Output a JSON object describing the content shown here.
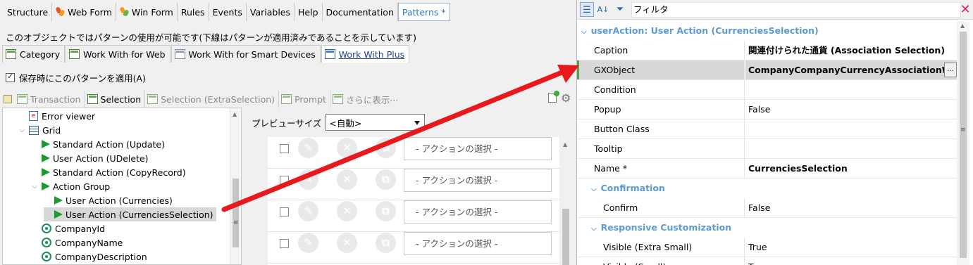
{
  "top_tabs": [
    {
      "label": "Structure",
      "icon": null
    },
    {
      "label": "Web Form",
      "icon": "webform-icon"
    },
    {
      "label": "Win Form",
      "icon": "winform-icon"
    },
    {
      "label": "Rules",
      "icon": null
    },
    {
      "label": "Events",
      "icon": null
    },
    {
      "label": "Variables",
      "icon": null
    },
    {
      "label": "Help",
      "icon": null
    },
    {
      "label": "Documentation",
      "icon": null
    },
    {
      "label": "Patterns *",
      "icon": null,
      "active": true
    }
  ],
  "info_text": "このオブジェクトではパターンの使用が可能です(下線はパターンが適用済みであることを示しています)",
  "pattern_tabs": [
    {
      "label": "Category"
    },
    {
      "label": "Work With for Web"
    },
    {
      "label": "Work With for Smart Devices"
    },
    {
      "label": "Work With Plus",
      "active": true
    }
  ],
  "apply_checkbox": {
    "label": "保存時にこのパターンを適用(A)",
    "checked": true
  },
  "instance_tabs": [
    {
      "label": "Transaction",
      "active": false
    },
    {
      "label": "Selection",
      "active": true
    },
    {
      "label": "Selection (ExtraSelection)",
      "active": false
    },
    {
      "label": "Prompt",
      "active": false
    },
    {
      "label": "さらに表示···",
      "active": false
    }
  ],
  "tree": [
    {
      "label": "Error viewer",
      "icon": "error-viewer-icon",
      "indent": 1,
      "expander": ""
    },
    {
      "label": "Grid",
      "icon": "grid-icon",
      "indent": 1,
      "expander": "⌵"
    },
    {
      "label": "Standard Action (Update)",
      "icon": "action-flag-icon",
      "indent": 2,
      "expander": ""
    },
    {
      "label": "User Action (UDelete)",
      "icon": "action-flag-icon",
      "indent": 2,
      "expander": ""
    },
    {
      "label": "Standard Action (CopyRecord)",
      "icon": "action-flag-icon",
      "indent": 2,
      "expander": ""
    },
    {
      "label": "Action Group",
      "icon": "action-flag-icon",
      "indent": 2,
      "expander": "⌵"
    },
    {
      "label": "User Action (Currencies)",
      "icon": "action-flag-icon",
      "indent": 3,
      "expander": ""
    },
    {
      "label": "User Action (CurrenciesSelection)",
      "icon": "action-flag-icon",
      "indent": 3,
      "expander": "",
      "selected": true
    },
    {
      "label": "CompanyId",
      "icon": "attribute-icon",
      "indent": 2,
      "expander": ""
    },
    {
      "label": "CompanyName",
      "icon": "attribute-icon",
      "indent": 2,
      "expander": ""
    },
    {
      "label": "CompanyDescription",
      "icon": "attribute-icon",
      "indent": 2,
      "expander": ""
    }
  ],
  "preview": {
    "size_label": "プレビューサイズ",
    "size_value": "<自動>",
    "action_select_placeholder": "- アクションの選択 -",
    "row_count": 4
  },
  "properties": {
    "filter_label": "フィルタ",
    "category_header": "userAction: User Action (CurrenciesSelection)",
    "rows": [
      {
        "name": "Caption",
        "value": "関連付けられた通貨 (Association Selection)",
        "bold": true
      },
      {
        "name": "GXObject",
        "value": "CompanyCompanyCurrencyAssociationWW",
        "bold": true,
        "selected": true,
        "ellipsis": "..."
      },
      {
        "name": "Condition",
        "value": "",
        "bold": false
      },
      {
        "name": "Popup",
        "value": "False",
        "bold": false
      },
      {
        "name": "Button Class",
        "value": "",
        "bold": false
      },
      {
        "name": "Tooltip",
        "value": "",
        "bold": false
      },
      {
        "name": "Name *",
        "value": "CurrenciesSelection",
        "bold": true
      }
    ],
    "confirmation": {
      "header": "Confirmation",
      "rows": [
        {
          "name": "Confirm",
          "value": "False"
        }
      ]
    },
    "responsive": {
      "header": "Responsive Customization",
      "rows": [
        {
          "name": "Visible (Extra Small)",
          "value": "True"
        },
        {
          "name": "Visible (Small)",
          "value": "True"
        }
      ]
    }
  },
  "colors": {
    "arrow": "#e8191c",
    "category_text": "#5b9bd5",
    "active_tab_text": "#2b79c2",
    "flag_green": "#1a9b30"
  }
}
